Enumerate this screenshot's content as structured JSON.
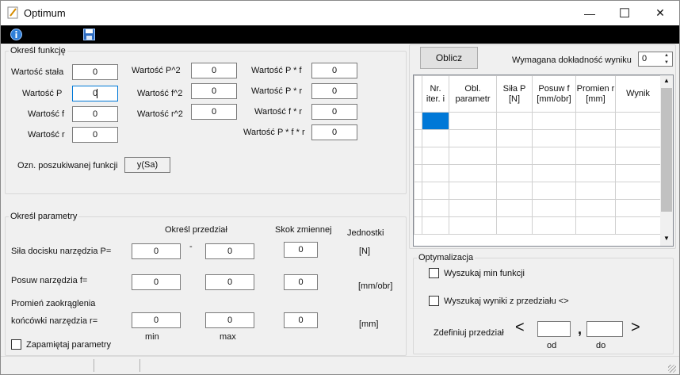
{
  "window": {
    "title": "Optimum",
    "minimize_glyph": "—",
    "maximize_glyph": "☐",
    "close_glyph": "✕"
  },
  "toolbar": {
    "icons": [
      "info-icon",
      "save-icon"
    ]
  },
  "function_group": {
    "legend": "Określ funkcję",
    "fields": [
      {
        "label": "Wartość stała",
        "value": "0"
      },
      {
        "label": "Wartość  P",
        "value": "0"
      },
      {
        "label": "Wartość f",
        "value": "0"
      },
      {
        "label": "Wartość r",
        "value": "0"
      },
      {
        "label": "Wartość  P^2",
        "value": "0"
      },
      {
        "label": "Wartość f^2",
        "value": "0"
      },
      {
        "label": "Wartość r^2",
        "value": "0"
      },
      {
        "label": "Wartość  P * f",
        "value": "0"
      },
      {
        "label": "Wartość  P * r",
        "value": "0"
      },
      {
        "label": "Wartość  f * r",
        "value": "0"
      },
      {
        "label": "Wartość P * f * r",
        "value": "0"
      }
    ],
    "function_name_label": "Ozn. poszukiwanej funkcji",
    "function_name_value": "y(Sa)"
  },
  "params_group": {
    "legend": "Określ parametry",
    "header_range": "Określ przedział",
    "header_step": "Skok zmiennej",
    "header_units": "Jednostki",
    "dash": "-",
    "rows": [
      {
        "label": "Siła docisku narzędzia P=",
        "min": "0",
        "max": "0",
        "step": "0",
        "unit": "[N]"
      },
      {
        "label": "Posuw narzędzia f=",
        "min": "0",
        "max": "0",
        "step": "0",
        "unit": "[mm/obr]"
      },
      {
        "label_line1": "Promień zaokrąglenia",
        "label": "końcówki narzędzia r=",
        "min": "0",
        "max": "0",
        "step": "0",
        "unit": "[mm]"
      }
    ],
    "min_label": "min",
    "max_label": "max",
    "remember_label": "Zapamiętaj parametry"
  },
  "calc": {
    "button_label": "Oblicz",
    "precision_label": "Wymagana dokładność wyniku",
    "precision_value": "0"
  },
  "results_grid": {
    "columns": [
      "Nr. iter. i",
      "Obl. parametr",
      "Siła P [N]",
      "Posuw f [mm/obr]",
      "Promien r [mm]",
      "Wynik"
    ],
    "empty_rows": 7
  },
  "optimization_group": {
    "legend": "Optymalizacja",
    "option_min": "Wyszukaj min funkcji",
    "option_range": "Wyszukaj wyniki z przedziału <>",
    "define_range_label": "Zdefiniuj przedział",
    "lt": "<",
    "gt": ">",
    "comma": ",",
    "from_label": "od",
    "to_label": "do",
    "from_value": "",
    "to_value": ""
  }
}
